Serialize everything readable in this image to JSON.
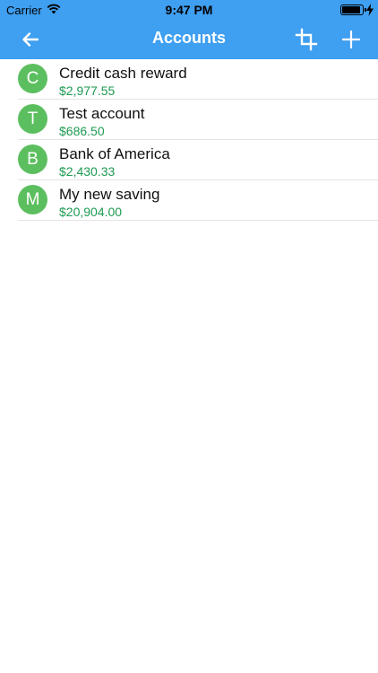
{
  "status_bar": {
    "carrier": "Carrier",
    "time": "9:47 PM",
    "battery_level": 0.9
  },
  "nav": {
    "title": "Accounts",
    "back_icon": "arrow-left-icon",
    "crop_icon": "crop-icon",
    "add_icon": "plus-icon"
  },
  "colors": {
    "header": "#3f9ff0",
    "avatar": "#5cbf5f",
    "balance": "#1e9a52"
  },
  "accounts": [
    {
      "initial": "C",
      "name": "Credit cash reward",
      "balance": "$2,977.55"
    },
    {
      "initial": "T",
      "name": "Test account",
      "balance": "$686.50"
    },
    {
      "initial": "B",
      "name": "Bank of America",
      "balance": "$2,430.33"
    },
    {
      "initial": "M",
      "name": "My new saving",
      "balance": "$20,904.00"
    }
  ]
}
